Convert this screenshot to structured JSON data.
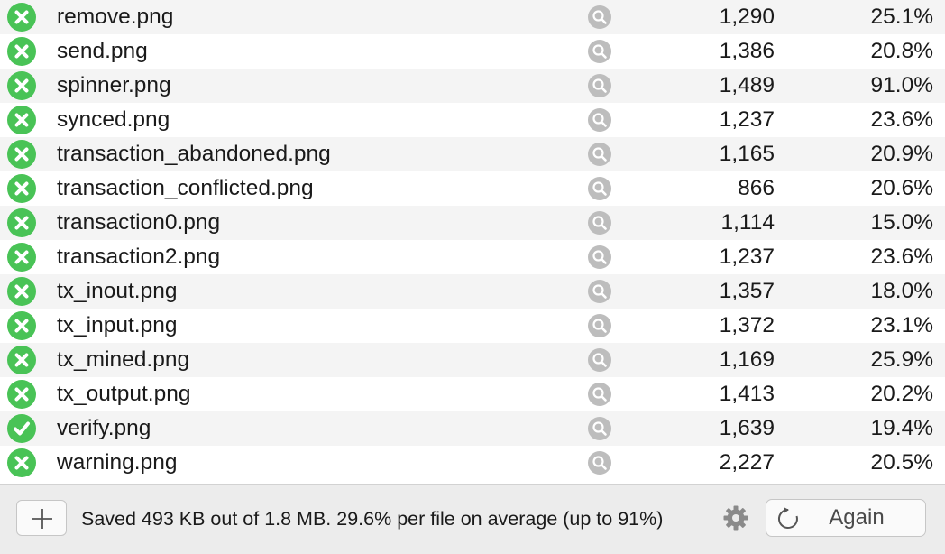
{
  "files": [
    {
      "name": "remove.png",
      "status": "error",
      "size": "1,290",
      "savings": "25.1%"
    },
    {
      "name": "send.png",
      "status": "error",
      "size": "1,386",
      "savings": "20.8%"
    },
    {
      "name": "spinner.png",
      "status": "error",
      "size": "1,489",
      "savings": "91.0%"
    },
    {
      "name": "synced.png",
      "status": "error",
      "size": "1,237",
      "savings": "23.6%"
    },
    {
      "name": "transaction_abandoned.png",
      "status": "error",
      "size": "1,165",
      "savings": "20.9%"
    },
    {
      "name": "transaction_conflicted.png",
      "status": "error",
      "size": "866",
      "savings": "20.6%"
    },
    {
      "name": "transaction0.png",
      "status": "error",
      "size": "1,114",
      "savings": "15.0%"
    },
    {
      "name": "transaction2.png",
      "status": "error",
      "size": "1,237",
      "savings": "23.6%"
    },
    {
      "name": "tx_inout.png",
      "status": "error",
      "size": "1,357",
      "savings": "18.0%"
    },
    {
      "name": "tx_input.png",
      "status": "error",
      "size": "1,372",
      "savings": "23.1%"
    },
    {
      "name": "tx_mined.png",
      "status": "error",
      "size": "1,169",
      "savings": "25.9%"
    },
    {
      "name": "tx_output.png",
      "status": "error",
      "size": "1,413",
      "savings": "20.2%"
    },
    {
      "name": "verify.png",
      "status": "ok",
      "size": "1,639",
      "savings": "19.4%"
    },
    {
      "name": "warning.png",
      "status": "error",
      "size": "2,227",
      "savings": "20.5%"
    }
  ],
  "footer": {
    "summary": "Saved 493 KB out of 1.8 MB. 29.6% per file on average (up to 91%)",
    "again_label": "Again"
  },
  "icons": {
    "status_error": "x-circle-icon",
    "status_ok": "checkmark-circle-icon",
    "zoom": "magnifier-icon",
    "add": "plus-icon",
    "settings": "gear-icon",
    "refresh": "refresh-icon"
  },
  "colors": {
    "status_green": "#49c356",
    "zoom_gray": "#bdbdbd",
    "row_stripe": "#f4f4f4",
    "footer_bg": "#ececec"
  }
}
